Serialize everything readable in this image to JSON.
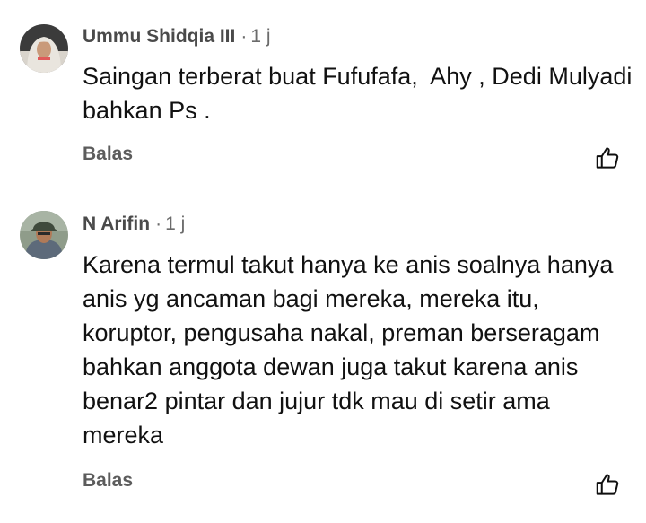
{
  "comments": [
    {
      "author": "Ummu Shidqia III",
      "separator": "·",
      "time": "1 j",
      "text": "Saingan terberat buat Fufufafa,  Ahy , Dedi Mulyadi bahkan Ps .",
      "reply_label": "Balas",
      "avatar_icon": "avatar-hijab-woman",
      "like_icon": "thumbs-up-outline-icon"
    },
    {
      "author": "N Arifin",
      "separator": "·",
      "time": "1 j",
      "text": "Karena termul takut hanya ke anis soalnya hanya anis yg ancaman bagi mereka, mereka itu, koruptor, pengusaha nakal, preman berseragam bahkan anggota dewan juga takut karena anis benar2 pintar dan jujur tdk mau di setir ama mereka",
      "reply_label": "Balas",
      "avatar_icon": "avatar-man-cap",
      "like_icon": "thumbs-up-outline-icon"
    }
  ],
  "colors": {
    "author": "#4a4a4a",
    "meta": "#6b6b6b",
    "text": "#111111",
    "reply": "#5c5c5c",
    "background": "#ffffff"
  }
}
